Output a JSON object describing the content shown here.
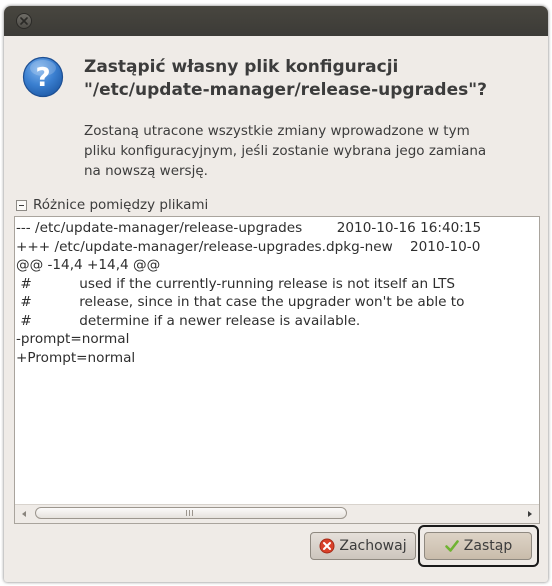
{
  "window": {
    "titlebar_close_icon": "close-icon"
  },
  "dialog": {
    "icon": "question-icon",
    "title_line1": "Zastąpić własny plik konfiguracji",
    "title_line2": "\"/etc/update-manager/release-upgrades\"?",
    "description_line1": "Zostaną utracone wszystkie zmiany wprowadzone w tym",
    "description_line2": "pliku konfiguracyjnym, jeśli zostanie wybrana jego zamiana",
    "description_line3": "na nowszą wersję."
  },
  "expander": {
    "label": "Różnice pomiędzy plikami",
    "expanded": true
  },
  "diff": {
    "lines": [
      "--- /etc/update-manager/release-upgrades        2010-10-16 16:40:15",
      "+++ /etc/update-manager/release-upgrades.dpkg-new    2010-10-0",
      "@@ -14,4 +14,4 @@",
      " #           used if the currently-running release is not itself an LTS",
      " #           release, since in that case the upgrader won't be able to",
      " #           determine if a newer release is available.",
      "-prompt=normal",
      "+Prompt=normal"
    ]
  },
  "buttons": {
    "keep_label": "Zachowaj",
    "replace_label": "Zastąp"
  },
  "colors": {
    "window_bg": "#efebe7",
    "titlebar": "#3c3b37",
    "keep_icon": "#d9412a",
    "replace_icon": "#6fb332",
    "question_icon": "#3a7fd0"
  }
}
